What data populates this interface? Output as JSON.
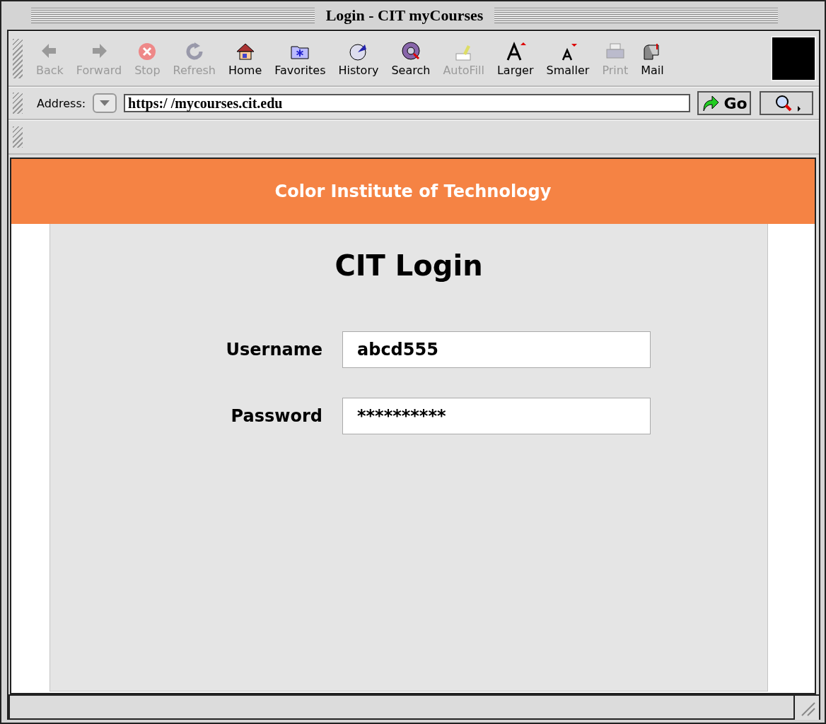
{
  "window": {
    "title": "Login - CIT myCourses"
  },
  "toolbar": {
    "buttons": [
      {
        "label": "Back",
        "kind": "back",
        "disabled": true
      },
      {
        "label": "Forward",
        "kind": "forward",
        "disabled": true
      },
      {
        "label": "Stop",
        "kind": "stop",
        "disabled": true
      },
      {
        "label": "Refresh",
        "kind": "refresh",
        "disabled": true
      },
      {
        "label": "Home",
        "kind": "home",
        "disabled": false
      },
      {
        "label": "Favorites",
        "kind": "favorites",
        "disabled": false
      },
      {
        "label": "History",
        "kind": "history",
        "disabled": false
      },
      {
        "label": "Search",
        "kind": "search",
        "disabled": false
      },
      {
        "label": "AutoFill",
        "kind": "autofill",
        "disabled": true
      },
      {
        "label": "Larger",
        "kind": "larger",
        "disabled": false
      },
      {
        "label": "Smaller",
        "kind": "smaller",
        "disabled": false
      },
      {
        "label": "Print",
        "kind": "print",
        "disabled": true
      },
      {
        "label": "Mail",
        "kind": "mail",
        "disabled": false
      }
    ]
  },
  "address_bar": {
    "label": "Address:",
    "value": "https:/ /mycourses.cit.edu",
    "go_button": "Go"
  },
  "page": {
    "banner": "Color Institute of Technology",
    "heading": "CIT Login",
    "fields": [
      {
        "label": "Username",
        "value": "abcd555"
      },
      {
        "label": "Password",
        "value": "**********"
      }
    ]
  }
}
